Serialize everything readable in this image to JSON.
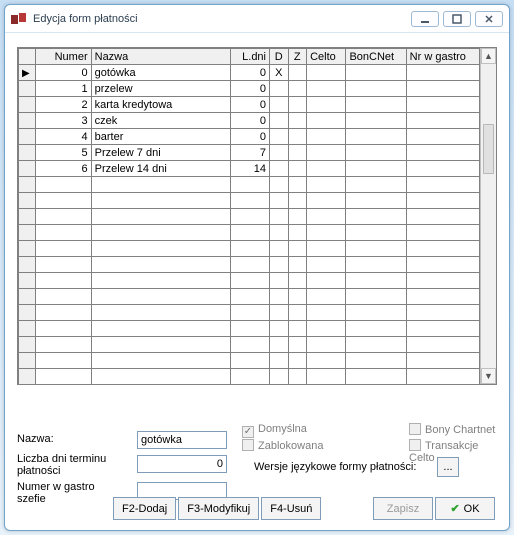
{
  "window": {
    "title": "Edycja form płatności"
  },
  "grid": {
    "headers": {
      "numer": "Numer",
      "nazwa": "Nazwa",
      "ldni": "L.dni",
      "d": "D",
      "z": "Z",
      "celto": "Celto",
      "boncnet": "BonCNet",
      "gastro": "Nr w gastro"
    },
    "rows": [
      {
        "sel": true,
        "numer": "0",
        "nazwa": "gotówka",
        "ldni": "0",
        "d": "X"
      },
      {
        "numer": "1",
        "nazwa": "przelew",
        "ldni": "0",
        "d": ""
      },
      {
        "numer": "2",
        "nazwa": "karta kredytowa",
        "ldni": "0",
        "d": ""
      },
      {
        "numer": "3",
        "nazwa": "czek",
        "ldni": "0",
        "d": ""
      },
      {
        "numer": "4",
        "nazwa": "barter",
        "ldni": "0",
        "d": ""
      },
      {
        "numer": "5",
        "nazwa": "Przelew 7 dni",
        "ldni": "7",
        "d": ""
      },
      {
        "numer": "6",
        "nazwa": "Przelew 14 dni",
        "ldni": "14",
        "d": ""
      }
    ]
  },
  "form": {
    "nazwa_label": "Nazwa:",
    "nazwa_value": "gotówka",
    "liczba_label": "Liczba dni terminu płatności",
    "liczba_value": "0",
    "gastro_label": "Numer w gastro szefie",
    "domyslna": "Domyślna",
    "zablokowana": "Zablokowana",
    "bony": "Bony Chartnet",
    "transakcje": "Transakcje Celto",
    "wersje": "Wersje językowe formy płatności:",
    "wersje_btn": "..."
  },
  "buttons": {
    "dodaj": "F2-Dodaj",
    "modyfikuj": "F3-Modyfikuj",
    "usun": "F4-Usuń",
    "zapisz": "Zapisz",
    "ok": "OK"
  }
}
